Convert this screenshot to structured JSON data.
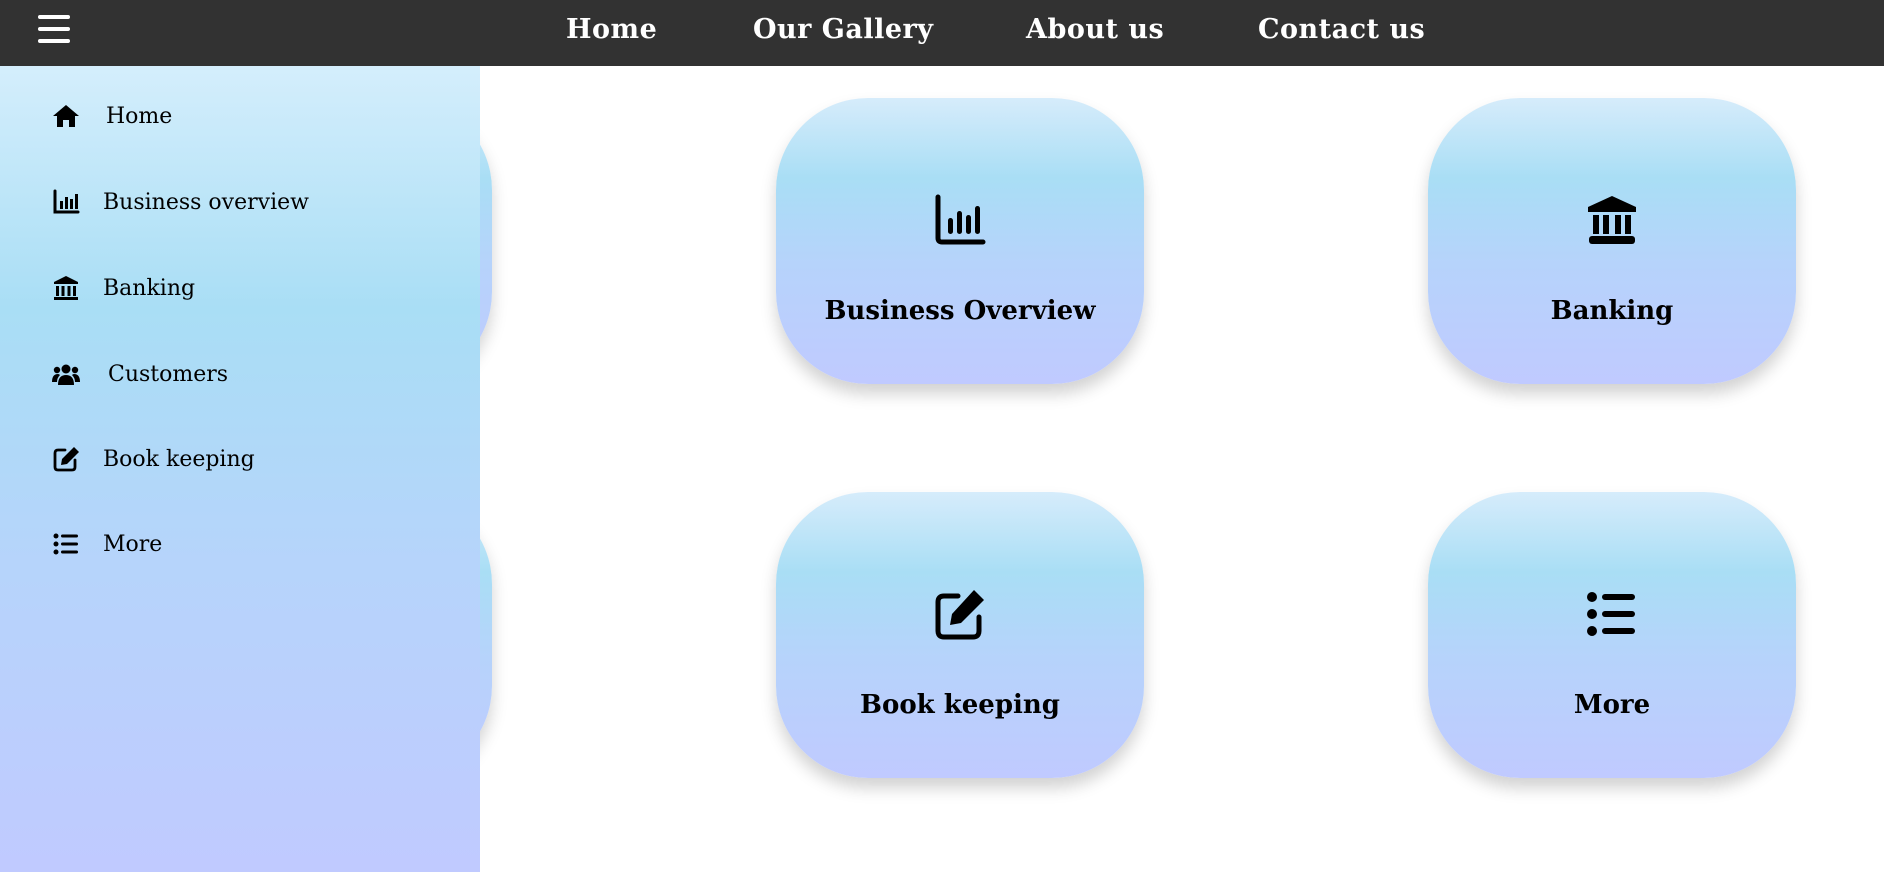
{
  "topbar": {
    "menu_icon": "hamburger-menu-icon",
    "links": [
      "Home",
      "Our Gallery",
      "About us",
      "Contact us"
    ]
  },
  "sidebar": {
    "items": [
      {
        "label": "Home",
        "icon": "home-icon"
      },
      {
        "label": "Business overview",
        "icon": "chart-icon"
      },
      {
        "label": "Banking",
        "icon": "bank-icon"
      },
      {
        "label": "Customers",
        "icon": "users-icon"
      },
      {
        "label": "Book keeping",
        "icon": "edit-icon"
      },
      {
        "label": "More",
        "icon": "list-icon"
      }
    ]
  },
  "cards": [
    {
      "label": "Business Overview",
      "icon": "chart-icon"
    },
    {
      "label": "Banking",
      "icon": "bank-icon"
    },
    {
      "label": "Book keeping",
      "icon": "edit-icon"
    },
    {
      "label": "More",
      "icon": "list-icon"
    }
  ],
  "colors": {
    "topbar_bg": "#323232",
    "gradient_top": "#d6ecfb",
    "gradient_mid": "#a9def5",
    "gradient_bottom": "#c0caff"
  }
}
